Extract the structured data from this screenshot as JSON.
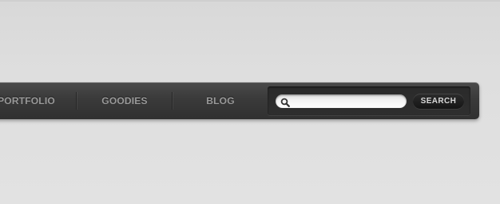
{
  "nav": {
    "items": [
      {
        "label": "PORTFOLIO"
      },
      {
        "label": "GOODIES"
      },
      {
        "label": "BLOG"
      }
    ]
  },
  "search": {
    "value": "",
    "placeholder": "",
    "button_label": "SEARCH",
    "icon": "magnifier-icon"
  },
  "colors": {
    "nav_bar": "#3a3a3a",
    "nav_text": "#9a9a9a",
    "search_button": "#1f1f1f",
    "page_background": "#dedede"
  }
}
